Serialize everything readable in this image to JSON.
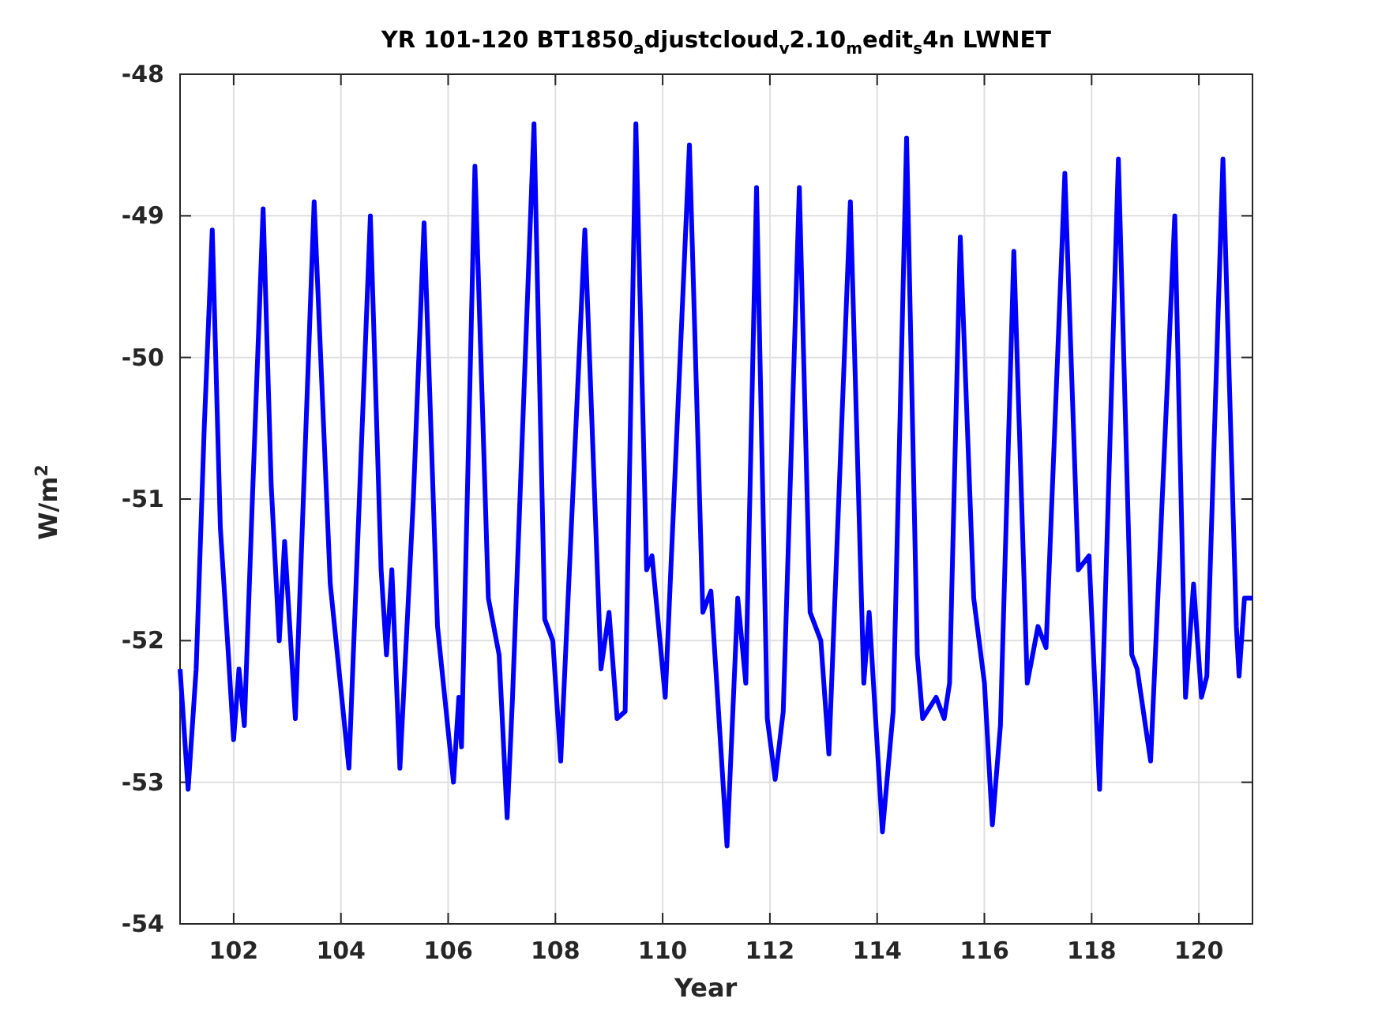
{
  "figure": {
    "chart_data": {
      "type": "line",
      "title": "YR 101-120 BT1850$_{a}$djustcloud$_{v}$2.10$_{m}$edit$_{s}$4n LWNET",
      "xlabel": "Year",
      "ylabel": "W/m$^{2}$",
      "x": [
        101.0,
        101.15,
        101.3,
        101.45,
        101.6,
        101.75,
        101.9,
        102.0,
        102.1,
        102.2,
        102.35,
        102.55,
        102.7,
        102.85,
        102.95,
        103.15,
        103.5,
        103.8,
        104.15,
        104.55,
        104.75,
        104.85,
        104.95,
        105.1,
        105.35,
        105.55,
        105.8,
        106.1,
        106.2,
        106.25,
        106.5,
        106.75,
        106.95,
        107.1,
        107.2,
        107.6,
        107.8,
        107.95,
        108.1,
        108.55,
        108.85,
        109.0,
        109.15,
        109.3,
        109.5,
        109.7,
        109.8,
        110.05,
        110.5,
        110.75,
        110.9,
        111.2,
        111.4,
        111.55,
        111.75,
        111.95,
        112.1,
        112.25,
        112.55,
        112.75,
        112.95,
        113.1,
        113.5,
        113.75,
        113.85,
        114.1,
        114.3,
        114.55,
        114.75,
        114.85,
        115.1,
        115.25,
        115.35,
        115.55,
        115.8,
        116.0,
        116.15,
        116.3,
        116.55,
        116.8,
        117.0,
        117.15,
        117.5,
        117.75,
        117.95,
        118.15,
        118.5,
        118.75,
        118.85,
        119.1,
        119.55,
        119.75,
        119.9,
        120.05,
        120.15,
        120.45,
        120.7,
        120.75,
        120.85,
        121.0
      ],
      "series": [
        {
          "color": "#0000ff",
          "values": [
            -52.2,
            -53.05,
            -52.2,
            -50.5,
            -49.1,
            -51.2,
            -52.1,
            -52.7,
            -52.2,
            -52.6,
            -51.0,
            -48.95,
            -50.9,
            -52.0,
            -51.3,
            -52.55,
            -48.9,
            -51.6,
            -52.9,
            -49.0,
            -51.5,
            -52.1,
            -51.5,
            -52.9,
            -51.0,
            -49.05,
            -51.9,
            -53.0,
            -52.4,
            -52.75,
            -48.65,
            -51.7,
            -52.1,
            -53.25,
            -52.4,
            -48.35,
            -51.85,
            -52.0,
            -52.85,
            -49.1,
            -52.2,
            -51.8,
            -52.55,
            -52.5,
            -48.35,
            -51.5,
            -51.4,
            -52.4,
            -48.5,
            -51.8,
            -51.65,
            -53.45,
            -51.7,
            -52.3,
            -48.8,
            -52.55,
            -52.98,
            -52.5,
            -48.8,
            -51.8,
            -52.0,
            -52.8,
            -48.9,
            -52.3,
            -51.8,
            -53.35,
            -52.5,
            -48.45,
            -52.1,
            -52.55,
            -52.4,
            -52.55,
            -52.3,
            -49.15,
            -51.7,
            -52.3,
            -53.3,
            -52.6,
            -49.25,
            -52.3,
            -51.9,
            -52.05,
            -48.7,
            -51.5,
            -51.4,
            -53.05,
            -48.6,
            -52.1,
            -52.2,
            -52.85,
            -49.0,
            -52.4,
            -51.6,
            -52.4,
            -52.25,
            -48.6,
            -51.9,
            -52.25,
            -51.7,
            -51.7
          ]
        }
      ],
      "grid": true,
      "xlim": [
        101,
        121
      ],
      "ylim": [
        -54,
        -48
      ],
      "xticks": [
        102,
        104,
        106,
        108,
        110,
        112,
        114,
        116,
        118,
        120
      ],
      "yticks": [
        -54,
        -53,
        -52,
        -51,
        -50,
        -49,
        -48
      ]
    }
  }
}
